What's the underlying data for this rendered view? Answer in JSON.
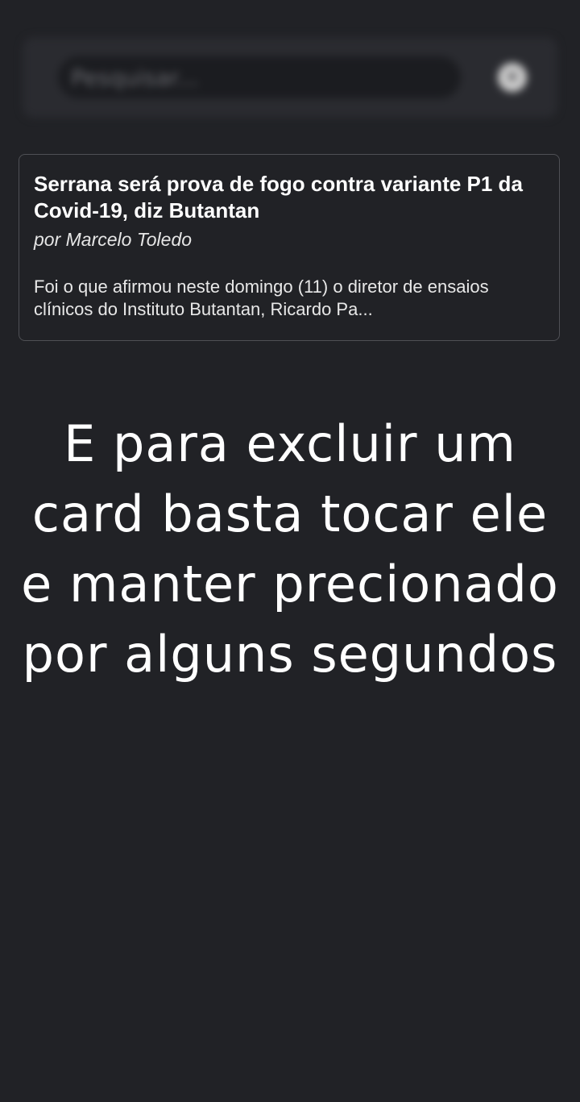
{
  "search": {
    "placeholder": "Pesquisar...",
    "clear_icon": "close-icon"
  },
  "card": {
    "title": "Serrana será prova de fogo contra variante P1 da Covid-19, diz Butantan",
    "author": "por Marcelo Toledo",
    "excerpt": "Foi o que afirmou neste domingo (11) o diretor de ensaios clínicos do Instituto Butantan, Ricardo Pa..."
  },
  "caption": {
    "lines": [
      "E para excluir um",
      "card basta tocar ele",
      "e manter precionado",
      "por alguns segundos"
    ]
  },
  "colors": {
    "background": "#212226",
    "card_border": "#4f5055",
    "text": "#ffffff"
  }
}
